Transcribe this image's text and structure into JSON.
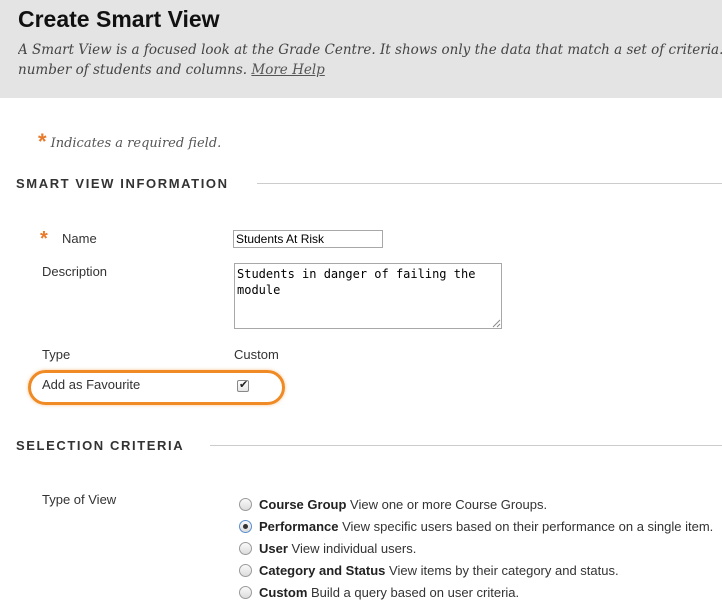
{
  "header": {
    "title": "Create Smart View",
    "description_line1": "A Smart View is a focused look at the Grade Centre. It shows only the data that match a set of criteria. Smart Vie",
    "description_line2": "number of students and columns.",
    "help_link": "More Help"
  },
  "required_note": {
    "star": "*",
    "text": "Indicates a required field."
  },
  "smart_view_information": {
    "heading": "SMART VIEW INFORMATION",
    "name_label": "Name",
    "name_value": "Students At Risk",
    "description_label": "Description",
    "description_value": "Students in danger of failing the module",
    "type_label": "Type",
    "type_value": "Custom",
    "favourite_label": "Add as Favourite",
    "favourite_checked": true,
    "check_glyph": "✔"
  },
  "selection_criteria": {
    "heading": "SELECTION CRITERIA",
    "type_of_view_label": "Type of View",
    "options": [
      {
        "title": "Course Group",
        "desc": "View one or more Course Groups.",
        "checked": false
      },
      {
        "title": "Performance",
        "desc": "View specific users based on their performance on a single item.",
        "checked": true
      },
      {
        "title": "User",
        "desc": "View individual users.",
        "checked": false
      },
      {
        "title": "Category and Status",
        "desc": "View items by their category and status.",
        "checked": false
      },
      {
        "title": "Custom",
        "desc": "Build a query based on user criteria.",
        "checked": false
      }
    ]
  },
  "colors": {
    "accent_orange": "#f08a24",
    "required_star": "#e87a2c",
    "header_bg": "#e4e4e4"
  }
}
